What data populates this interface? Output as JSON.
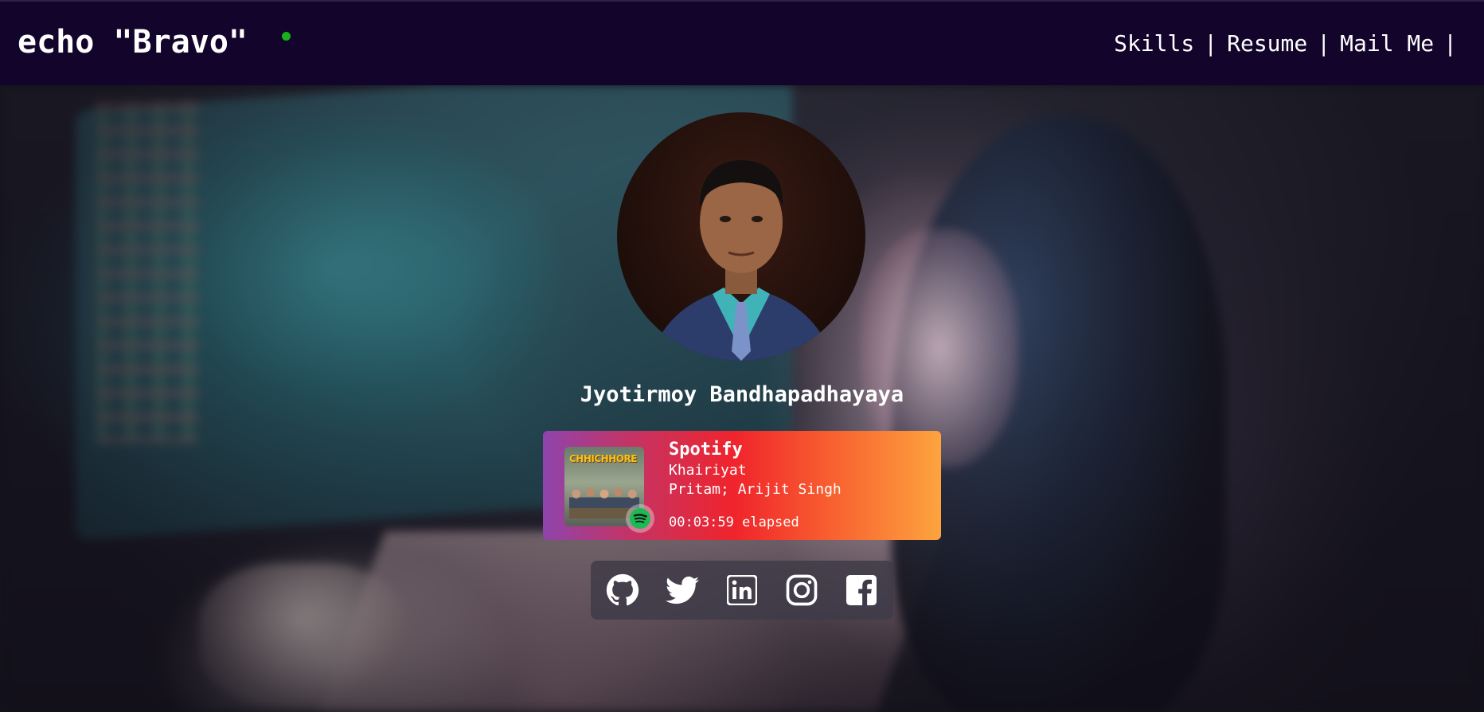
{
  "header": {
    "brand": "echo \"Bravo\"",
    "status_color": "#16b21a",
    "nav": [
      {
        "label": "Skills"
      },
      {
        "label": "Resume"
      },
      {
        "label": "Mail Me"
      }
    ],
    "separator": "|"
  },
  "profile": {
    "name": "Jyotirmoy Bandhapadhayaya"
  },
  "now_playing": {
    "source": "Spotify",
    "track": "Khairiyat",
    "artist": "Pritam; Arijit Singh",
    "elapsed": "00:03:59 elapsed",
    "album_art_text": "CHHICHHORE"
  },
  "social": [
    {
      "icon": "github-icon"
    },
    {
      "icon": "twitter-icon"
    },
    {
      "icon": "linkedin-icon"
    },
    {
      "icon": "instagram-icon"
    },
    {
      "icon": "facebook-icon"
    }
  ],
  "colors": {
    "header_bg": "#12042b",
    "spotify_green": "#1db954"
  }
}
